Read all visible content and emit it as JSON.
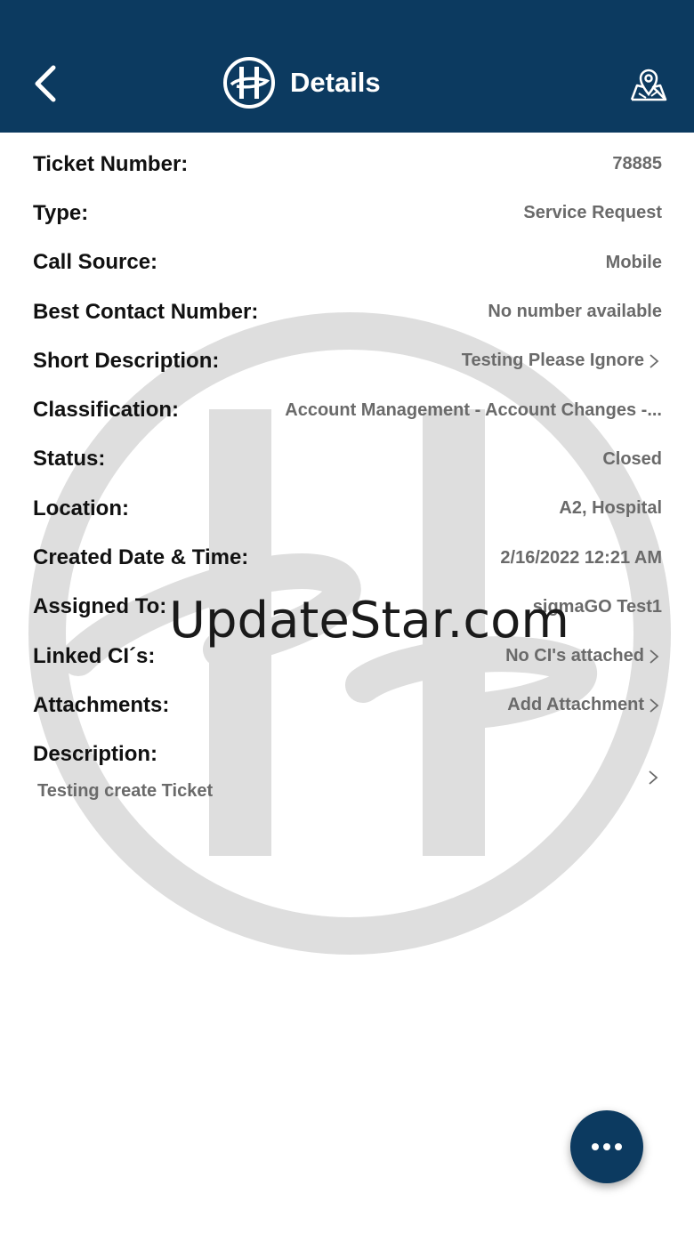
{
  "header": {
    "title": "Details",
    "back_icon": "chevron-left-icon",
    "map_icon": "map-pin-icon",
    "background": "#0c3a60"
  },
  "fields": [
    {
      "label": "Ticket Number:",
      "value": "78885"
    },
    {
      "label": "Type:",
      "value": "Service Request"
    },
    {
      "label": "Call Source:",
      "value": "Mobile"
    },
    {
      "label": "Best Contact Number:",
      "value": "No number available"
    },
    {
      "label": "Short Description:",
      "value": "Testing Please Ignore"
    },
    {
      "label": "Classification:",
      "value": "Account Management - Account Changes -..."
    },
    {
      "label": "Status:",
      "value": "Closed"
    },
    {
      "label": "Location:",
      "value": "A2, Hospital"
    },
    {
      "label": "Created Date & Time:",
      "value": "2/16/2022 12:21 AM"
    },
    {
      "label": "Assigned To:",
      "value": "sigmaGO Test1"
    },
    {
      "label": "Linked CI´s:",
      "value": "No CI's attached"
    },
    {
      "label": "Attachments:",
      "value": "Add Attachment"
    }
  ],
  "description": {
    "label": "Description:",
    "value": "Testing create Ticket"
  },
  "watermark": {
    "text": "UpdateStar.com"
  },
  "fab": {
    "icon": "more-horizontal-icon"
  }
}
